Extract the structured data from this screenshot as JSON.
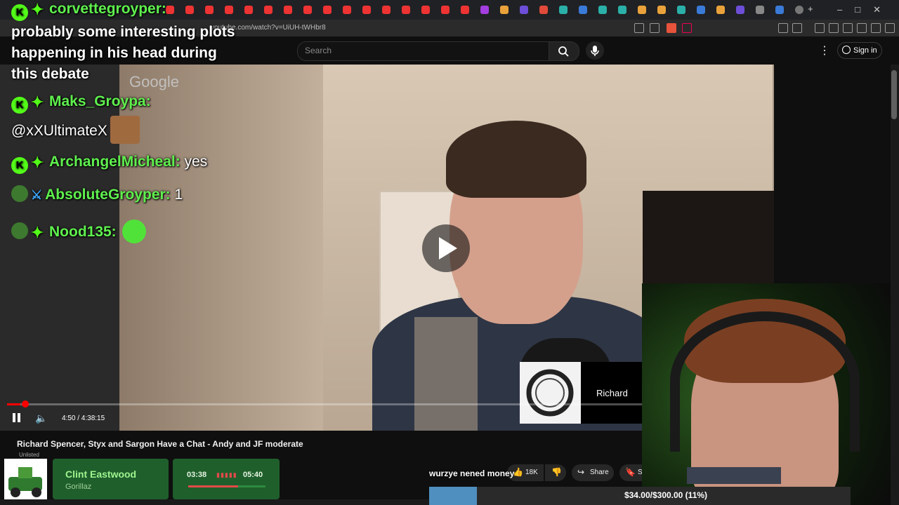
{
  "browser": {
    "url": "youtube.com/watch?v=UiUH-tWHbr8",
    "window_controls": [
      "–",
      "□",
      "✕"
    ]
  },
  "youtube": {
    "search_placeholder": "Search",
    "sign_in_label": "Sign in",
    "kebab_glyph": "⋮",
    "watermark": "Google"
  },
  "video": {
    "title": "Richard Spencer, Styx and Sargon Have a Chat - Andy and JF moderate",
    "visibility": "Unlisted",
    "time_current": "4:50",
    "time_total": "4:38:15",
    "time_display": "4:50 / 4:38:15",
    "progress_fraction": 0.0174,
    "participant_name": "Richard",
    "likes": "18K",
    "share_label": "Share",
    "save_label": "Save"
  },
  "chat": [
    {
      "user": "corvettegroyper:",
      "text": "probably some interesting plots happening in his head during this debate"
    },
    {
      "user": "Maks_Groypa:",
      "text": "@xXUltimateX"
    },
    {
      "user": "ArchangelMicheal:",
      "text": "yes"
    },
    {
      "user": "AbsoluteGroyper:",
      "text": "1"
    },
    {
      "user": "Nood135:",
      "text": ""
    }
  ],
  "now_playing": {
    "title": "Clint Eastwood",
    "artist": "Gorillaz",
    "elapsed": "03:38",
    "total": "05:40",
    "progress_fraction": 0.641
  },
  "donation": {
    "caption": "wurzye nened money",
    "goal_text": "$34.00/$300.00 (11%)",
    "fraction": 0.1133
  },
  "colors": {
    "chat_username": "#5ff04e",
    "kick_green": "#53fc18",
    "yt_red": "#ff0000",
    "song_card": "#1f5f2c",
    "donation_fill": "#4f8fbf"
  }
}
